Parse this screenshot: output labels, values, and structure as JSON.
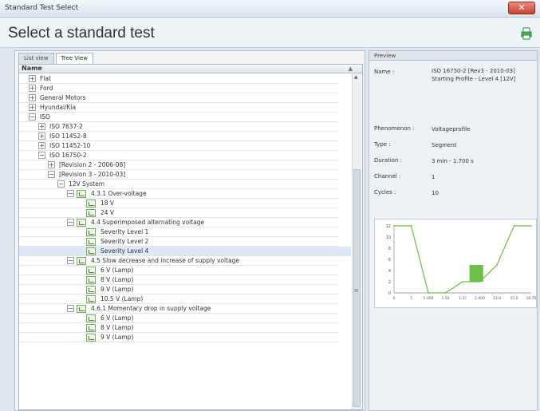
{
  "window": {
    "title": "Standard Test Select",
    "close_label": "✕"
  },
  "header": {
    "title": "Select a standard test"
  },
  "tabs": [
    {
      "label": "List view",
      "active": false
    },
    {
      "label": "Tree View",
      "active": true
    }
  ],
  "tree": {
    "column_header": "Name",
    "rows": [
      {
        "label": "Flat",
        "indent": 0,
        "expander": "+"
      },
      {
        "label": "Ford",
        "indent": 0,
        "expander": "+"
      },
      {
        "label": "General Motors",
        "indent": 0,
        "expander": "+"
      },
      {
        "label": "Hyundai/Kia",
        "indent": 0,
        "expander": "+"
      },
      {
        "label": "ISO",
        "indent": 0,
        "expander": "−"
      },
      {
        "label": "ISO 7637-2",
        "indent": 1,
        "expander": "+"
      },
      {
        "label": "ISO 11452-8",
        "indent": 1,
        "expander": "+"
      },
      {
        "label": "ISO 11452-10",
        "indent": 1,
        "expander": "+"
      },
      {
        "label": "ISO 16750-2",
        "indent": 1,
        "expander": "−"
      },
      {
        "label": "[Revision 2 - 2006-08]",
        "indent": 2,
        "expander": "+"
      },
      {
        "label": "[Revision 3 - 2010-03]",
        "indent": 2,
        "expander": "−"
      },
      {
        "label": "12V System",
        "indent": 3,
        "expander": "−"
      },
      {
        "label": "4.3.1 Over-voltage",
        "indent": 4,
        "expander": "−",
        "icon": true
      },
      {
        "label": "18 V",
        "indent": 5,
        "icon": true
      },
      {
        "label": "24 V",
        "indent": 5,
        "icon": true
      },
      {
        "label": "4.4 Superimposed alternating voltage",
        "indent": 4,
        "expander": "−",
        "icon": true
      },
      {
        "label": "Severity Level 1",
        "indent": 5,
        "icon": true
      },
      {
        "label": "Severity Level 2",
        "indent": 5,
        "icon": true
      },
      {
        "label": "Severity Level 4",
        "indent": 5,
        "icon": true,
        "selected": true
      },
      {
        "label": "4.5 Slow decrease and increase of supply voltage",
        "indent": 4,
        "expander": "−",
        "icon": true
      },
      {
        "label": "6 V (Lamp)",
        "indent": 5,
        "icon": true
      },
      {
        "label": "8 V (Lamp)",
        "indent": 5,
        "icon": true
      },
      {
        "label": "9 V (Lamp)",
        "indent": 5,
        "icon": true
      },
      {
        "label": "10.5 V (Lamp)",
        "indent": 5,
        "icon": true
      },
      {
        "label": "4.6.1 Momentary drop in supply voltage",
        "indent": 4,
        "expander": "−",
        "icon": true
      },
      {
        "label": "6 V (Lamp)",
        "indent": 5,
        "icon": true
      },
      {
        "label": "8 V (Lamp)",
        "indent": 5,
        "icon": true
      },
      {
        "label": "9 V (Lamp)",
        "indent": 5,
        "icon": true
      }
    ]
  },
  "preview": {
    "header": "Preview",
    "props": [
      {
        "label": "Name :",
        "value": "ISO 16750-2 [Rev3 - 2010-03] Starting Profile - Level 4 [12V]"
      },
      {
        "label": "Phenomenon :",
        "value": "Voltageprofile"
      },
      {
        "label": "Type :",
        "value": "Segment"
      },
      {
        "label": "Duration :",
        "value": "3 min - 1.700 s"
      },
      {
        "label": "Channel :",
        "value": "1"
      },
      {
        "label": "Cycles :",
        "value": "10"
      }
    ],
    "chart_data": {
      "type": "line",
      "title": "",
      "xlabel": "",
      "ylabel": "",
      "x": [
        0,
        1,
        2,
        3,
        4,
        5,
        6,
        7,
        8
      ],
      "values": [
        12,
        12,
        0,
        0,
        2,
        2,
        5,
        12,
        12
      ],
      "ylim": [
        0,
        12
      ],
      "y_ticks": [
        "0",
        "2",
        "4",
        "6",
        "8",
        "10",
        "12"
      ],
      "x_ticks": [
        "0",
        "1",
        "1.000",
        "1.50",
        "1.37",
        "2.000",
        "13.0",
        "15.0",
        "16.75"
      ],
      "highlight": {
        "x_from": 4.4,
        "x_to": 5.2,
        "y_from": 2,
        "y_to": 5,
        "color": "#6cc04a"
      },
      "line_color": "#6cc04a",
      "grid": false
    }
  },
  "colors": {
    "accent_green": "#6cc04a",
    "selection": "#dde9f6",
    "close_red": "#c9432d"
  },
  "icons": {
    "close": "close-icon",
    "print": "print-icon",
    "tree_item": "test-item-icon",
    "expander": "expander-icon"
  }
}
